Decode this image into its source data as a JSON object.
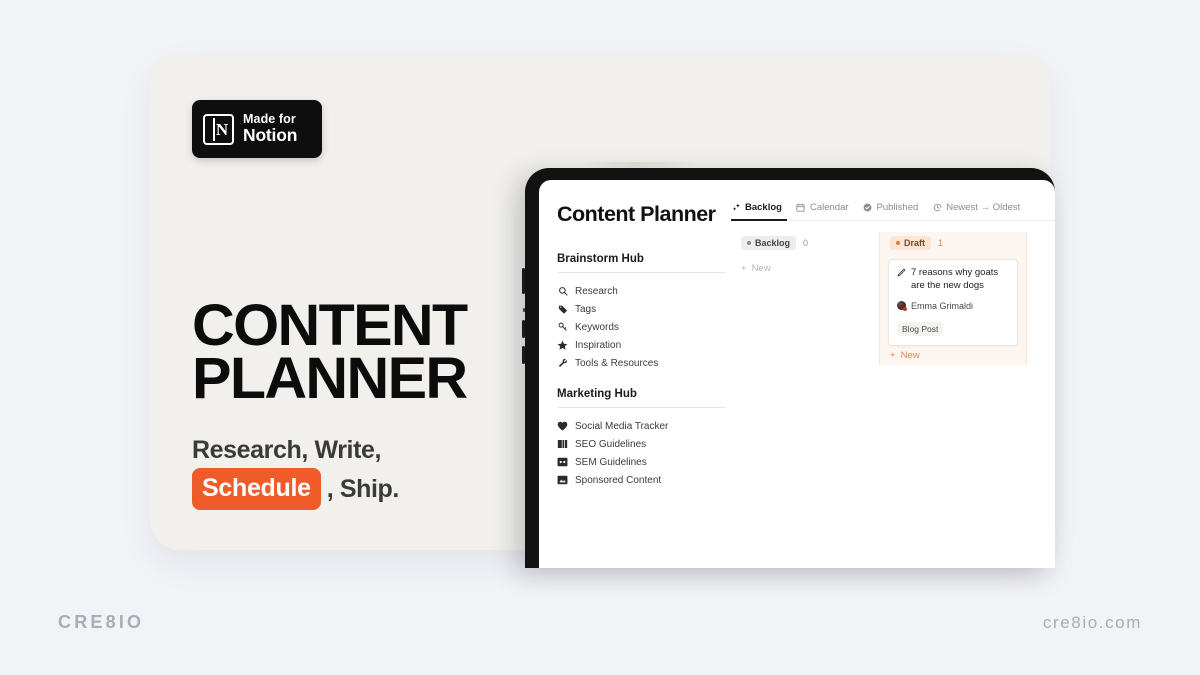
{
  "colors": {
    "background": "#F2F3F7",
    "card": "#F1F0EC",
    "accent": "#EF5B29",
    "bezel": "#121212",
    "muted": "#A9ADB8"
  },
  "badge": {
    "line1": "Made for",
    "line2": "Notion",
    "glyph_letter": "N",
    "icon": "notion-logo-icon"
  },
  "headline": {
    "line1": "CONTENT",
    "line2": "PLANNER"
  },
  "subhead": {
    "line1": "Research, Write,",
    "pill": "Schedule",
    "tail": ", Ship."
  },
  "app": {
    "page_title": "Content Planner",
    "sidebar": [
      {
        "heading": "Brainstorm Hub",
        "items": [
          {
            "label": "Research",
            "icon": "search-icon"
          },
          {
            "label": "Tags",
            "icon": "tag-icon"
          },
          {
            "label": "Keywords",
            "icon": "key-icon"
          },
          {
            "label": "Inspiration",
            "icon": "star-icon"
          },
          {
            "label": "Tools & Resources",
            "icon": "wrench-icon"
          }
        ]
      },
      {
        "heading": "Marketing Hub",
        "items": [
          {
            "label": "Social Media Tracker",
            "icon": "heart-icon"
          },
          {
            "label": "SEO Guidelines",
            "icon": "book-icon"
          },
          {
            "label": "SEM Guidelines",
            "icon": "image-icon"
          },
          {
            "label": "Sponsored Content",
            "icon": "picture-icon"
          }
        ]
      }
    ],
    "tabs": [
      {
        "label": "Backlog",
        "icon": "sparkle-icon",
        "active": true
      },
      {
        "label": "Calendar",
        "icon": "calendar-icon",
        "active": false
      },
      {
        "label": "Published",
        "icon": "check-circle-icon",
        "active": false
      },
      {
        "label": "Newest → Oldest",
        "icon": "sort-icon",
        "active": false
      }
    ],
    "board": {
      "columns": [
        {
          "name": "Backlog",
          "count": "0",
          "new_label": "New",
          "cards": []
        },
        {
          "name": "Draft",
          "count": "1",
          "new_label": "New",
          "cards": [
            {
              "title": "7 reasons why goats are the new dogs",
              "person": "Emma Grimaldi",
              "tag": "Blog Post",
              "icon": "pencil-icon"
            }
          ]
        }
      ]
    }
  },
  "footer": {
    "brand": "CRE8IO",
    "site": "cre8io.com"
  }
}
